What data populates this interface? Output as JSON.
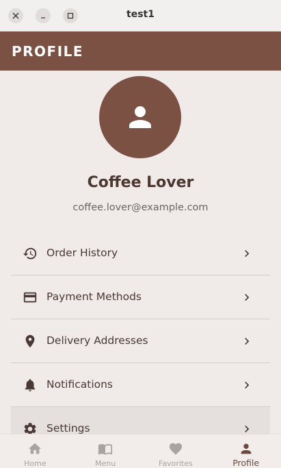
{
  "window": {
    "title": "test1",
    "close_glyph": "×",
    "minimize_glyph": "–",
    "maximize_glyph": "□"
  },
  "appbar": {
    "title": "PROFILE"
  },
  "profile": {
    "name": "Coffee Lover",
    "email": "coffee.lover@example.com",
    "avatar_icon": "person-icon"
  },
  "menu": {
    "items": [
      {
        "label": "Order History",
        "icon": "history-icon"
      },
      {
        "label": "Payment Methods",
        "icon": "credit-card-icon"
      },
      {
        "label": "Delivery Addresses",
        "icon": "location-pin-icon"
      },
      {
        "label": "Notifications",
        "icon": "bell-icon"
      },
      {
        "label": "Settings",
        "icon": "gear-icon"
      }
    ]
  },
  "bottom_nav": {
    "items": [
      {
        "label": "Home",
        "icon": "home-icon",
        "active": false
      },
      {
        "label": "Menu",
        "icon": "book-icon",
        "active": false
      },
      {
        "label": "Favorites",
        "icon": "heart-icon",
        "active": false
      },
      {
        "label": "Profile",
        "icon": "person-icon",
        "active": true
      }
    ]
  },
  "colors": {
    "accent": "#7b5143",
    "background": "#f0ebe8",
    "inactive_nav": "#a9a3a1",
    "active_nav": "#6a4a40"
  }
}
